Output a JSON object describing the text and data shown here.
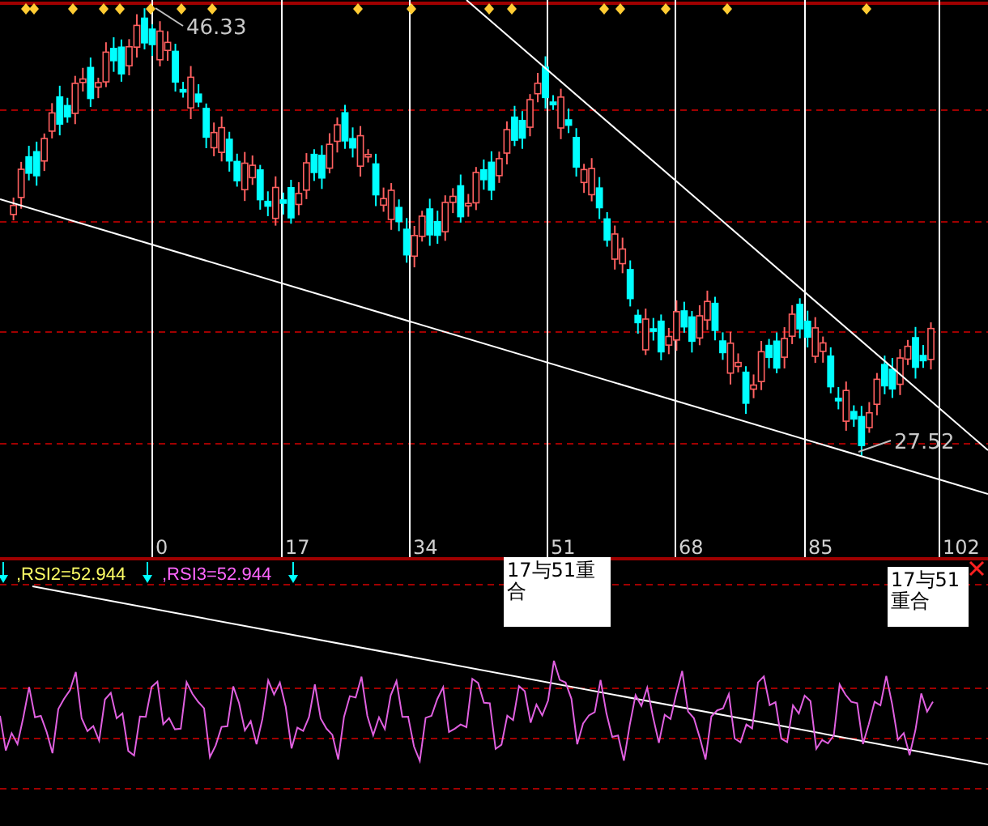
{
  "price_panel": {
    "high_label": "46.33",
    "low_label": "27.52",
    "x_ticks": [
      "0",
      "17",
      "34",
      "51",
      "68",
      "85",
      "102"
    ]
  },
  "indicator_panel": {
    "legend": [
      {
        "text": ",RSI2=52.944",
        "color": "#ffff66"
      },
      {
        "text": ",RSI3=52.944",
        "color": "#ff66ff"
      }
    ],
    "notes": [
      "17与51重合",
      "17与51重合"
    ]
  }
}
